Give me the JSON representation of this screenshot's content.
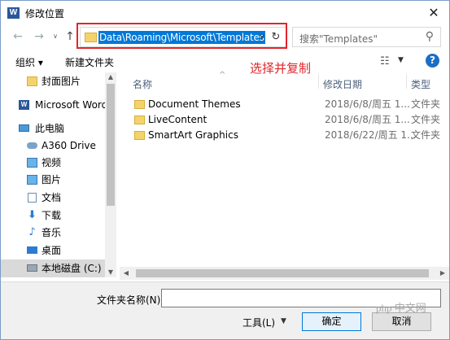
{
  "title": "修改位置",
  "app_icon_letter": "W",
  "nav": {
    "back": "←",
    "forward": "→",
    "up": "↑"
  },
  "address": {
    "path": "Data\\Roaming\\Microsoft\\Templates",
    "dropdown": "∨",
    "refresh": "↻"
  },
  "search": {
    "placeholder": "搜索\"Templates\""
  },
  "toolbar": {
    "organize": "组织 ▾",
    "new_folder": "新建文件夹"
  },
  "annotation": "选择并复制",
  "sidebar": {
    "items": [
      {
        "label": "封面图片",
        "icon": "folder"
      },
      {
        "label": "Microsoft Word",
        "icon": "word"
      },
      {
        "label": "此电脑",
        "icon": "pc"
      },
      {
        "label": "A360 Drive",
        "icon": "cloud"
      },
      {
        "label": "视频",
        "icon": "img"
      },
      {
        "label": "图片",
        "icon": "img"
      },
      {
        "label": "文档",
        "icon": "doc"
      },
      {
        "label": "下载",
        "icon": "arrow"
      },
      {
        "label": "音乐",
        "icon": "music"
      },
      {
        "label": "桌面",
        "icon": "desk"
      },
      {
        "label": "本地磁盘 (C:)",
        "icon": "disk"
      }
    ],
    "selected_index": 10
  },
  "columns": {
    "name": "名称",
    "date": "修改日期",
    "type": "类型"
  },
  "files": [
    {
      "name": "Document Themes",
      "date": "2018/6/8/周五 1...",
      "type": "文件夹"
    },
    {
      "name": "LiveContent",
      "date": "2018/6/8/周五 1...",
      "type": "文件夹"
    },
    {
      "name": "SmartArt Graphics",
      "date": "2018/6/22/周五 1...",
      "type": "文件夹"
    }
  ],
  "footer": {
    "filename_label": "文件夹名称(N):",
    "filename_value": "",
    "tools": "工具(L)",
    "ok": "确定",
    "cancel": "取消"
  },
  "watermark": "php 中文网",
  "colors": {
    "accent": "#0078d7",
    "annotation": "#e0262b",
    "folder": "#f5d36b"
  }
}
